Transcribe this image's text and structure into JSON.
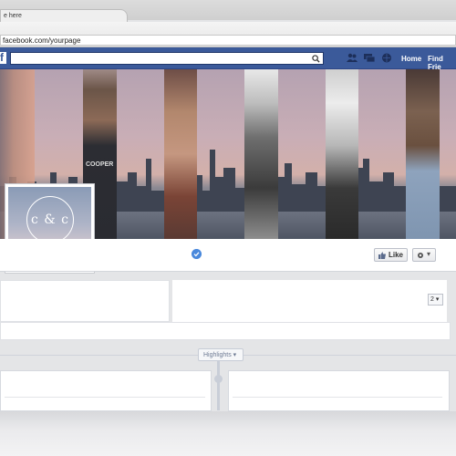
{
  "browser": {
    "tab_title": "e here",
    "url": "facebook.com/yourpage"
  },
  "fb_header": {
    "logo": "f",
    "search_placeholder": "",
    "nav_links": [
      "Home",
      "Find Frie"
    ],
    "icons": [
      "friends-icon",
      "messages-icon",
      "notifications-icon",
      "search-icon"
    ]
  },
  "cover": {
    "shirt_text": "COOPER"
  },
  "profile": {
    "monogram": "c & c"
  },
  "actions": {
    "like_label": "Like",
    "settings_caret": "▾"
  },
  "about": {
    "count_label": "2 ▾"
  },
  "timeline": {
    "highlights_label": "Highlights ▾"
  },
  "colors": {
    "fb_blue": "#3b5a9a",
    "verified_blue": "#4a89dc"
  }
}
